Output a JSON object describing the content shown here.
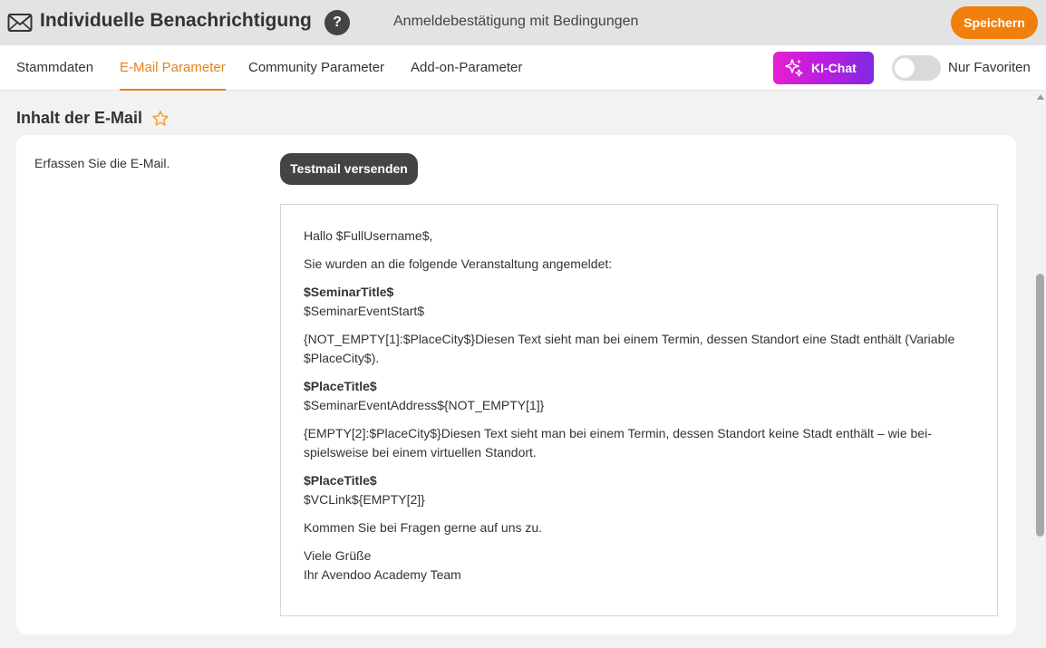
{
  "header": {
    "icon": "envelope-icon",
    "title": "Individuelle Benachrichtigung",
    "help_label": "?",
    "subtitle": "Anmeldebestätigung mit Bedingungen",
    "save_label": "Speichern",
    "accent_color": "#f07f0c"
  },
  "tabs": [
    {
      "label": "Stammdaten",
      "active": false
    },
    {
      "label": "E-Mail Parameter",
      "active": true
    },
    {
      "label": "Community Parameter",
      "active": false
    },
    {
      "label": "Add-on-Parameter",
      "active": false
    }
  ],
  "ki_chat": {
    "label": "KI-Chat",
    "icon": "sparkles-icon"
  },
  "favorites_toggle": {
    "label": "Nur Favoriten",
    "on": false
  },
  "section": {
    "title": "Inhalt der E-Mail",
    "favorite_icon": "star-outline-icon"
  },
  "card": {
    "label": "Erfassen Sie die E-Mail.",
    "test_button": "Testmail versenden"
  },
  "email": {
    "greeting": "Hallo $FullUsername$,",
    "intro": "Sie wurden an die folgende Veranstaltung angemeldet:",
    "seminar_title": "$SeminarTitle$",
    "seminar_start": "$SeminarEventStart$",
    "cond1_line1": "{NOT_EMPTY[1]:$PlaceCity$}Diesen Text sieht man bei einem Termin, dessen Standort eine Stadt enthält (Variable",
    "cond1_line2": "$PlaceCity$).",
    "place_title_1": "$PlaceTitle$",
    "address_line": "$SeminarEventAddress${NOT_EMPTY[1]}",
    "cond2_line1": "{EMPTY[2]:$PlaceCity$}Diesen Text sieht man bei einem Termin, dessen Standort keine Stadt enthält – wie bei-",
    "cond2_line2": "spielsweise bei einem virtuellen Standort.",
    "place_title_2": "$PlaceTitle$",
    "vclink_line": "$VCLink${EMPTY[2]}",
    "questions": "Kommen Sie bei Fragen gerne auf uns zu.",
    "closing": "Viele Grüße",
    "signature": "Ihr Avendoo Academy Team"
  }
}
